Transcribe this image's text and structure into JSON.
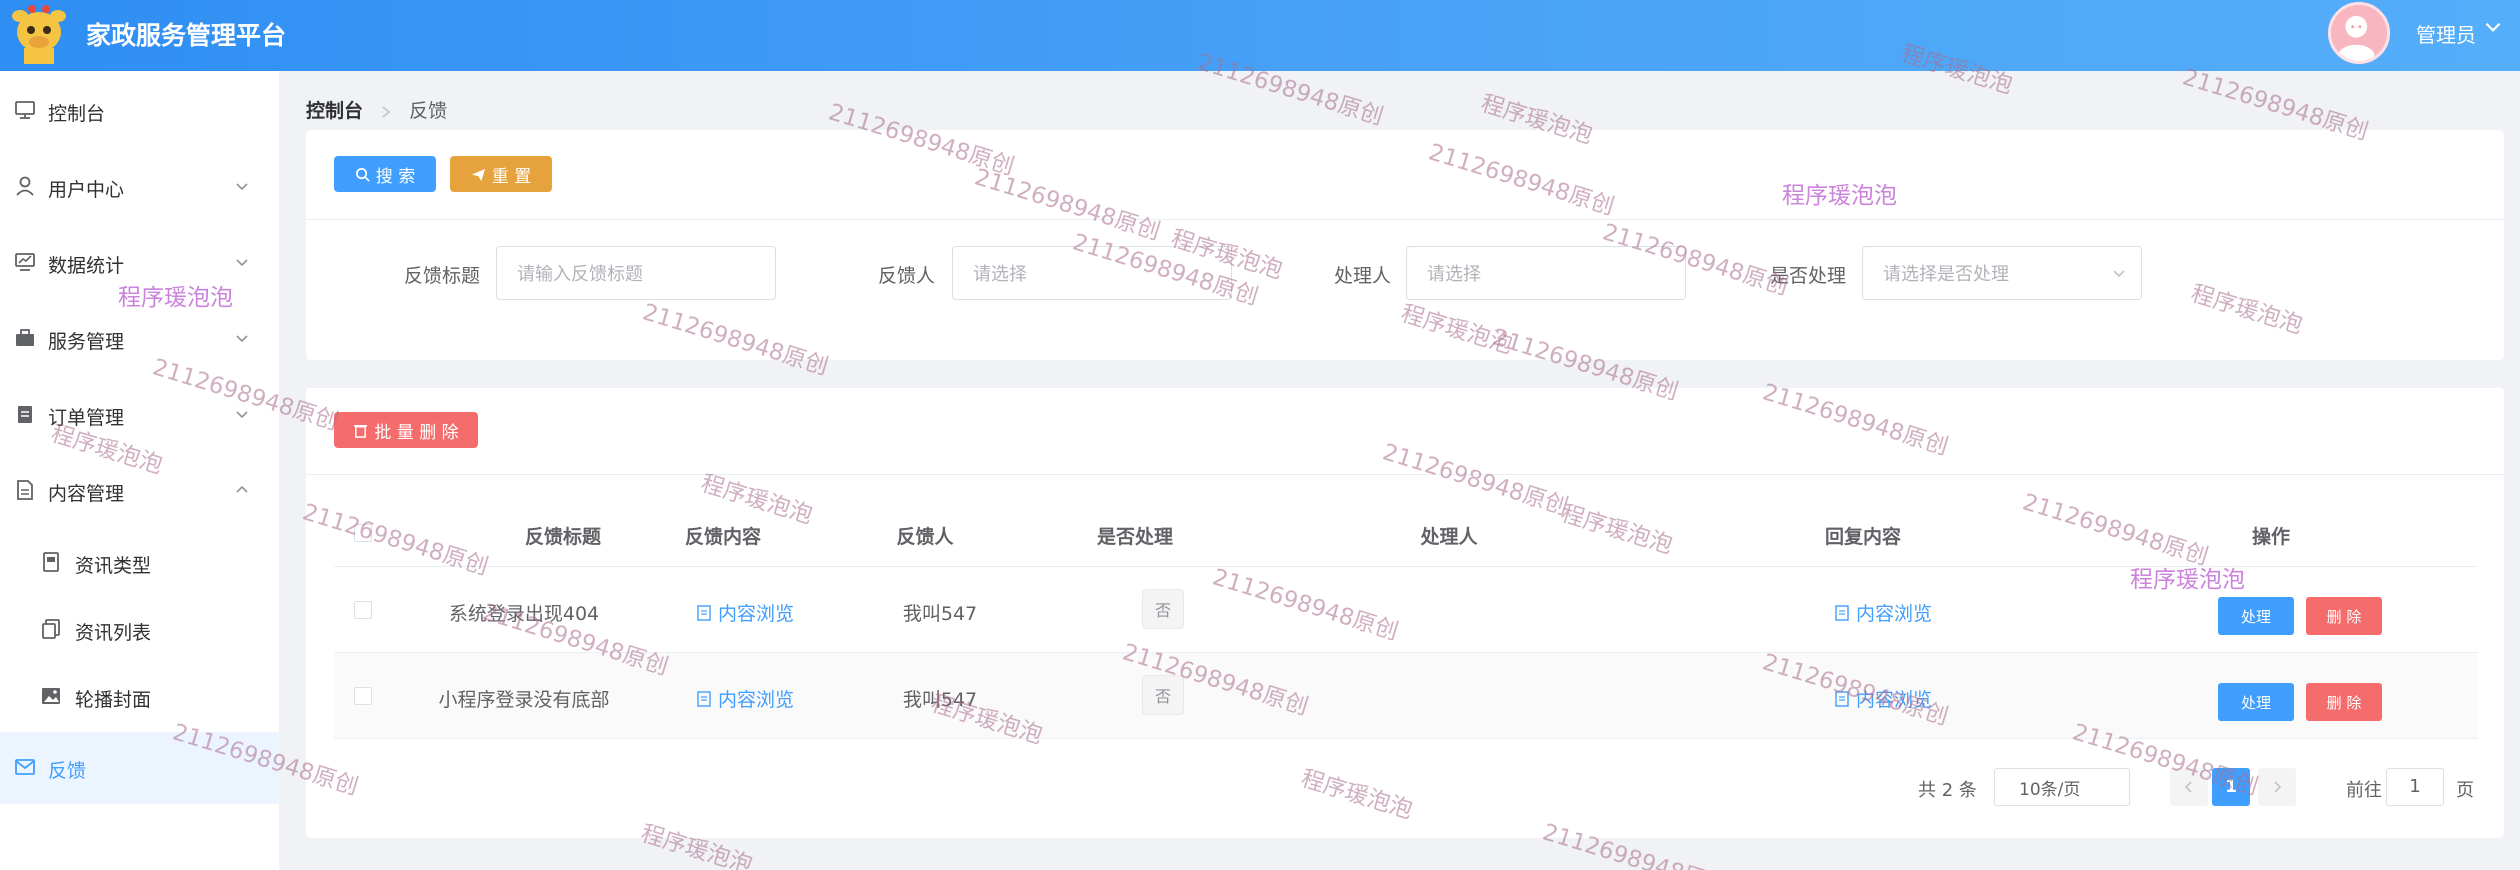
{
  "app": {
    "title": "家政服务管理平台"
  },
  "user": {
    "name": "管理员"
  },
  "sidebar": {
    "items": [
      {
        "label": "控制台",
        "icon": "dashboard-icon"
      },
      {
        "label": "用户中心",
        "icon": "user-icon"
      },
      {
        "label": "数据统计",
        "icon": "chart-icon"
      },
      {
        "label": "服务管理",
        "icon": "briefcase-icon"
      },
      {
        "label": "订单管理",
        "icon": "order-icon"
      },
      {
        "label": "内容管理",
        "icon": "document-icon"
      },
      {
        "label": "资讯类型",
        "icon": "type-icon"
      },
      {
        "label": "资讯列表",
        "icon": "copy-icon"
      },
      {
        "label": "轮播封面",
        "icon": "picture-icon"
      },
      {
        "label": "反馈",
        "icon": "message-icon"
      }
    ]
  },
  "breadcrumb": {
    "home": "控制台",
    "current": "反馈"
  },
  "search": {
    "search_button": "搜 索",
    "reset_button": "重 置",
    "fields": [
      {
        "label": "反馈标题",
        "placeholder": "请输入反馈标题"
      },
      {
        "label": "反馈人",
        "placeholder": "请选择"
      },
      {
        "label": "处理人",
        "placeholder": "请选择"
      },
      {
        "label": "是否处理",
        "placeholder": "请选择是否处理"
      }
    ]
  },
  "toolbar": {
    "batch_delete": "批 量 删 除"
  },
  "table": {
    "columns": [
      "反馈标题",
      "反馈内容",
      "反馈人",
      "是否处理",
      "处理人",
      "回复内容",
      "操作"
    ],
    "rows": [
      {
        "title": "系统登录出现404",
        "content_link": "内容浏览",
        "feedback_user": "我叫547",
        "handled": "否",
        "handler": "",
        "reply_link": "内容浏览",
        "action_handle": "处理",
        "action_delete": "删 除"
      },
      {
        "title": "小程序登录没有底部",
        "content_link": "内容浏览",
        "feedback_user": "我叫547",
        "handled": "否",
        "handler": "",
        "reply_link": "内容浏览",
        "action_handle": "处理",
        "action_delete": "删 除"
      }
    ]
  },
  "pagination": {
    "total": "共 2 条",
    "page_size": "10条/页",
    "current_page": "1",
    "goto_label": "前往",
    "goto_value": "1",
    "page_unit": "页"
  },
  "watermarks": {
    "a": "2112698948原创",
    "b": "程序瑗泡泡"
  },
  "colors": {
    "primary": "#409eff",
    "warning": "#e6a23c",
    "danger": "#f56c6c",
    "header": "#3a97f5"
  }
}
